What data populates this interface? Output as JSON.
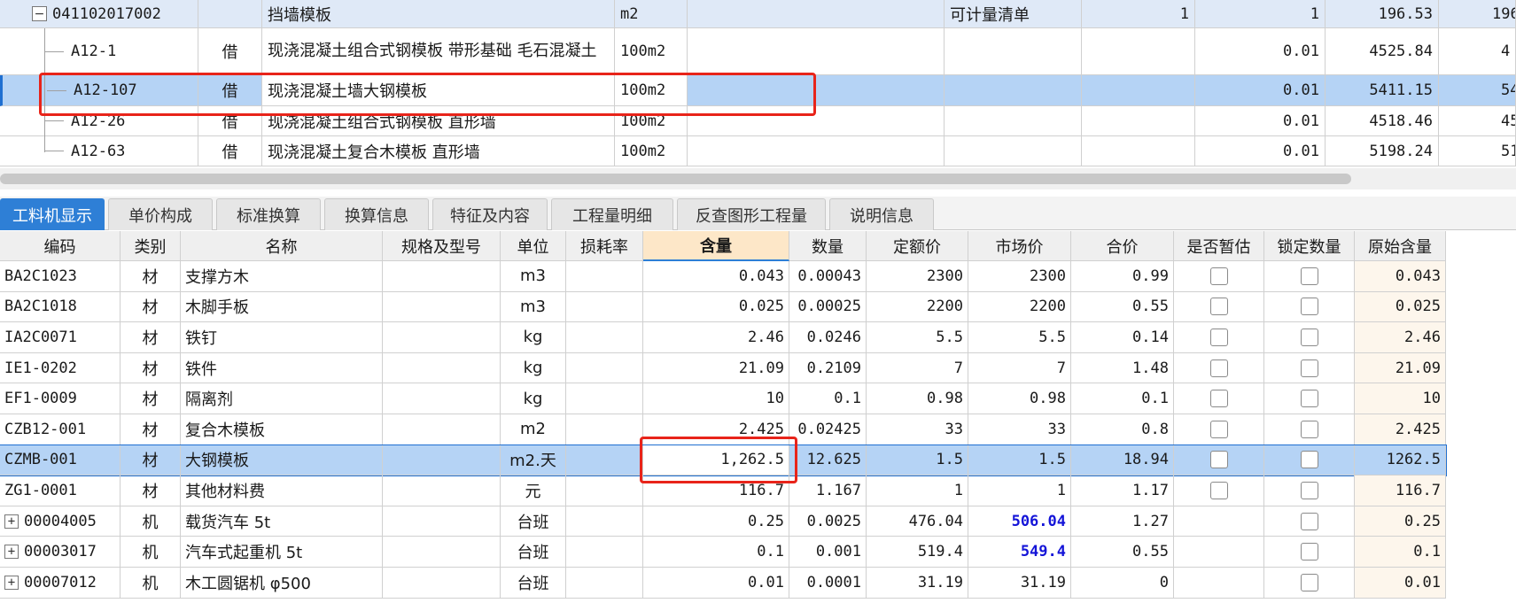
{
  "top_grid": {
    "rows": [
      {
        "code": "041102017002",
        "kind": "",
        "name": "挡墙模板",
        "unit": "m2",
        "expr": "",
        "type": "可计量清单",
        "qty_expr": "1",
        "qty": "1",
        "price": "196.53",
        "total": "196",
        "expanded_icon": "minus-icon"
      },
      {
        "code": "A12-1",
        "kind": "借",
        "name": "现浇混凝土组合式钢模板 带形基础 毛石混凝土",
        "unit": "100m2",
        "expr": "",
        "type": "",
        "qty_expr": "",
        "qty": "0.01",
        "price": "4525.84",
        "total": "4"
      },
      {
        "code": "A12-107",
        "kind": "借",
        "name": "现浇混凝土墙大钢模板",
        "unit": "100m2",
        "expr": "",
        "type": "",
        "qty_expr": "",
        "qty": "0.01",
        "price": "5411.15",
        "total": "54"
      },
      {
        "code": "A12-26",
        "kind": "借",
        "name": "现浇混凝土组合式钢模板 直形墙",
        "unit": "100m2",
        "expr": "",
        "type": "",
        "qty_expr": "",
        "qty": "0.01",
        "price": "4518.46",
        "total": "45"
      },
      {
        "code": "A12-63",
        "kind": "借",
        "name": "现浇混凝土复合木模板 直形墙",
        "unit": "100m2",
        "expr": "",
        "type": "",
        "qty_expr": "",
        "qty": "0.01",
        "price": "5198.24",
        "total": "51"
      }
    ]
  },
  "tabs": [
    {
      "label": "工料机显示",
      "active": true
    },
    {
      "label": "单价构成"
    },
    {
      "label": "标准换算"
    },
    {
      "label": "换算信息"
    },
    {
      "label": "特征及内容"
    },
    {
      "label": "工程量明细"
    },
    {
      "label": "反查图形工程量"
    },
    {
      "label": "说明信息"
    }
  ],
  "bottom_grid": {
    "headers": [
      "编码",
      "类别",
      "名称",
      "规格及型号",
      "单位",
      "损耗率",
      "含量",
      "数量",
      "定额价",
      "市场价",
      "合价",
      "是否暂估",
      "锁定数量",
      "原始含量"
    ],
    "rows": [
      {
        "code": "BA2C1023",
        "kind": "材",
        "name": "支撑方木",
        "spec": "",
        "unit": "m3",
        "loss": "",
        "content": "0.043",
        "qty": "0.00043",
        "quota": "2300",
        "market": "2300",
        "sum": "0.99",
        "est": "",
        "lock": "",
        "orig": "0.043"
      },
      {
        "code": "BA2C1018",
        "kind": "材",
        "name": "木脚手板",
        "spec": "",
        "unit": "m3",
        "loss": "",
        "content": "0.025",
        "qty": "0.00025",
        "quota": "2200",
        "market": "2200",
        "sum": "0.55",
        "est": "",
        "lock": "",
        "orig": "0.025"
      },
      {
        "code": "IA2C0071",
        "kind": "材",
        "name": "铁钉",
        "spec": "",
        "unit": "kg",
        "loss": "",
        "content": "2.46",
        "qty": "0.0246",
        "quota": "5.5",
        "market": "5.5",
        "sum": "0.14",
        "est": "",
        "lock": "",
        "orig": "2.46"
      },
      {
        "code": "IE1-0202",
        "kind": "材",
        "name": "铁件",
        "spec": "",
        "unit": "kg",
        "loss": "",
        "content": "21.09",
        "qty": "0.2109",
        "quota": "7",
        "market": "7",
        "sum": "1.48",
        "est": "",
        "lock": "",
        "orig": "21.09"
      },
      {
        "code": "EF1-0009",
        "kind": "材",
        "name": "隔离剂",
        "spec": "",
        "unit": "kg",
        "loss": "",
        "content": "10",
        "qty": "0.1",
        "quota": "0.98",
        "market": "0.98",
        "sum": "0.1",
        "est": "",
        "lock": "",
        "orig": "10"
      },
      {
        "code": "CZB12-001",
        "kind": "材",
        "name": "复合木模板",
        "spec": "",
        "unit": "m2",
        "loss": "",
        "content": "2.425",
        "qty": "0.02425",
        "quota": "33",
        "market": "33",
        "sum": "0.8",
        "est": "",
        "lock": "",
        "orig": "2.425"
      },
      {
        "code": "CZMB-001",
        "kind": "材",
        "name": "大钢模板",
        "spec": "",
        "unit": "m2.天",
        "loss": "",
        "content": "1,262.5",
        "qty": "12.625",
        "quota": "1.5",
        "market": "1.5",
        "sum": "18.94",
        "est": "",
        "lock": "",
        "orig": "1262.5"
      },
      {
        "code": "ZG1-0001",
        "kind": "材",
        "name": "其他材料费",
        "spec": "",
        "unit": "元",
        "loss": "",
        "content": "116.7",
        "qty": "1.167",
        "quota": "1",
        "market": "1",
        "sum": "1.17",
        "est": "",
        "lock": "",
        "orig": "116.7"
      },
      {
        "code": "00004005",
        "kind": "机",
        "name": "载货汽车 5t",
        "spec": "",
        "unit": "台班",
        "loss": "",
        "content": "0.25",
        "qty": "0.0025",
        "quota": "476.04",
        "market": "506.04",
        "sum": "1.27",
        "est": "",
        "lock": "",
        "orig": "0.25",
        "plus": "+"
      },
      {
        "code": "00003017",
        "kind": "机",
        "name": "汽车式起重机 5t",
        "spec": "",
        "unit": "台班",
        "loss": "",
        "content": "0.1",
        "qty": "0.001",
        "quota": "519.4",
        "market": "549.4",
        "sum": "0.55",
        "est": "",
        "lock": "",
        "orig": "0.1",
        "plus": "+"
      },
      {
        "code": "00007012",
        "kind": "机",
        "name": "木工圆锯机 φ500",
        "spec": "",
        "unit": "台班",
        "loss": "",
        "content": "0.01",
        "qty": "0.0001",
        "quota": "31.19",
        "market": "31.19",
        "sum": "0",
        "est": "",
        "lock": "",
        "orig": "0.01",
        "plus": "+"
      }
    ]
  },
  "colors": {
    "accent": "#2e7fd6",
    "highlight": "#e8241a",
    "selected": "#b5d3f5",
    "market_bold": "#1414d8"
  }
}
